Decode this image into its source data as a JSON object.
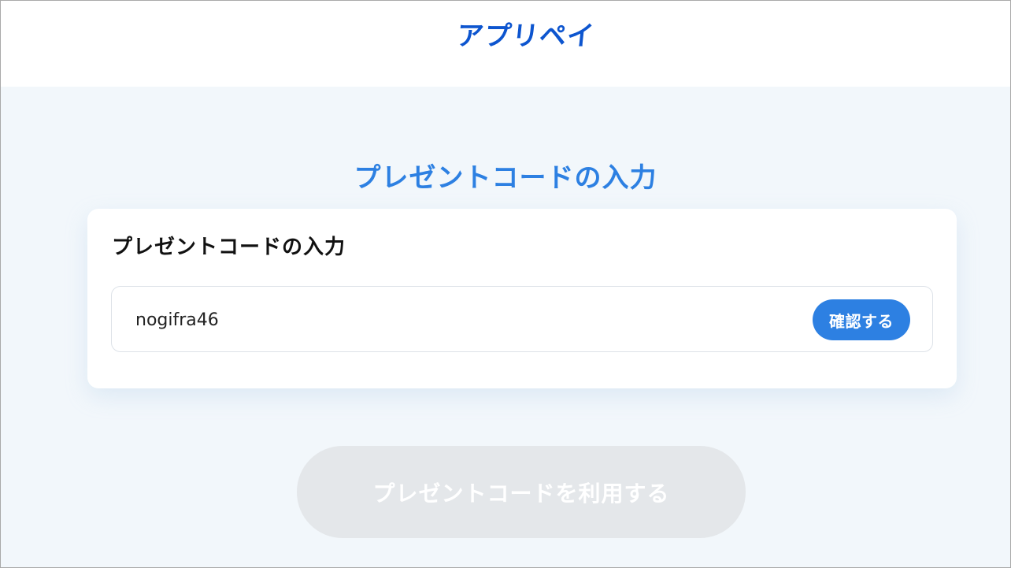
{
  "header": {
    "logo_text": "アプリペイ"
  },
  "page": {
    "title": "プレゼントコードの入力"
  },
  "card": {
    "title": "プレゼントコードの入力",
    "code_value": "nogifra46",
    "confirm_label": "確認する"
  },
  "footer": {
    "use_button_label": "プレゼントコードを利用する",
    "use_button_disabled": true
  },
  "colors": {
    "brand": "#0d55cf",
    "accent": "#2d80e2",
    "background": "#f2f7fb",
    "disabled_button": "#e4e7ea"
  }
}
